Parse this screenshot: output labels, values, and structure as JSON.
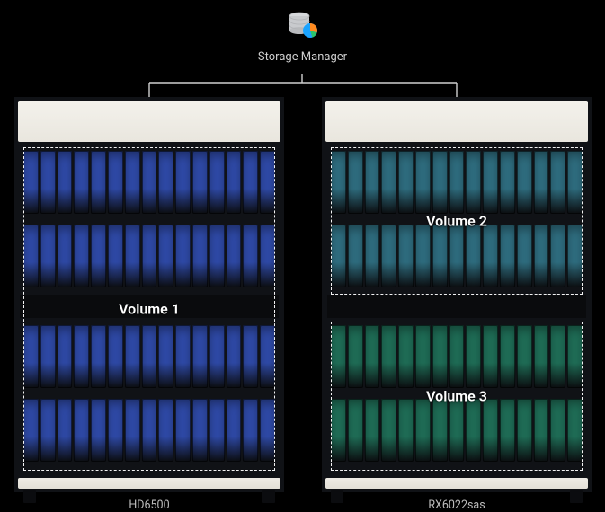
{
  "header": {
    "label": "Storage Manager",
    "icon_name": "storage-manager-icon"
  },
  "devices": [
    {
      "id": "left",
      "model": "HD6500",
      "drive_rows": 4,
      "drives_per_row": 15,
      "volumes": [
        {
          "id": "vol1",
          "label": "Volume 1",
          "rows": [
            0,
            1,
            2,
            3
          ],
          "color": "#2f4aa8"
        }
      ]
    },
    {
      "id": "right",
      "model": "RX6022sas",
      "drive_rows": 4,
      "drives_per_row": 15,
      "volumes": [
        {
          "id": "vol2",
          "label": "Volume 2",
          "rows": [
            0,
            1
          ],
          "color": "#2f6e80"
        },
        {
          "id": "vol3",
          "label": "Volume 3",
          "rows": [
            2,
            3
          ],
          "color": "#1f6e57"
        }
      ]
    }
  ],
  "colors": {
    "volume1": "#2f4aa8",
    "volume2": "#2f6e80",
    "volume3": "#1f6e57"
  }
}
